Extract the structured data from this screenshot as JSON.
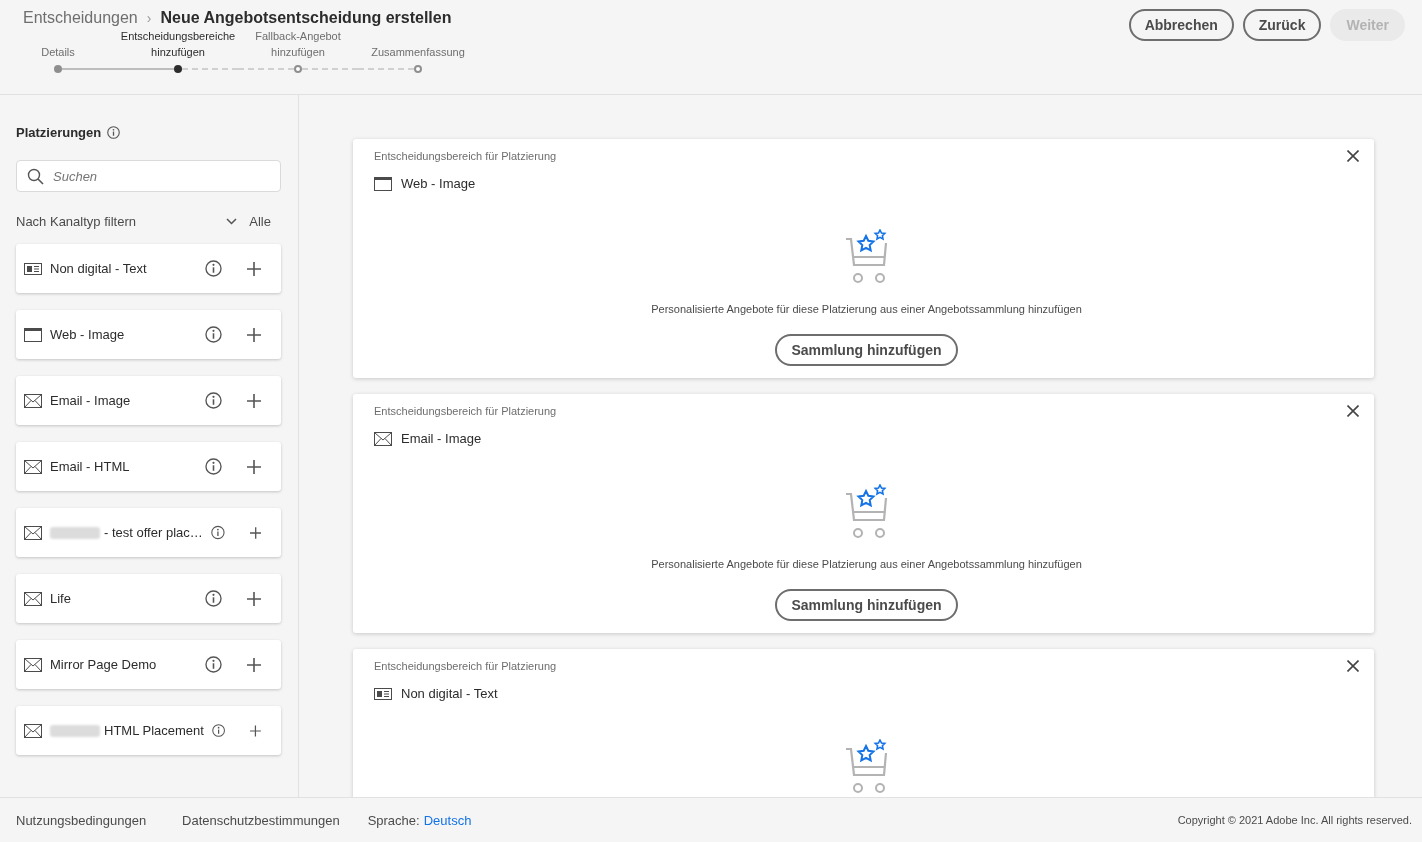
{
  "breadcrumb": {
    "parent": "Entscheidungen",
    "separator": "›",
    "current": "Neue Angebotsentscheidung erstellen"
  },
  "steps": [
    {
      "label": "Details",
      "kind": "done"
    },
    {
      "label": "Entscheidungsbereiche hinzufügen",
      "kind": "current"
    },
    {
      "label": "Fallback-Angebot hinzufügen",
      "kind": "upcoming"
    },
    {
      "label": "Zusammenfassung",
      "kind": "upcoming"
    }
  ],
  "header_buttons": [
    {
      "label": "Abbrechen",
      "disabled": false
    },
    {
      "label": "Zurück",
      "disabled": false
    },
    {
      "label": "Weiter",
      "disabled": true
    }
  ],
  "sidebar": {
    "title": "Platzierungen",
    "search": {
      "placeholder": "Suchen"
    },
    "filter": {
      "label": "Nach Kanaltyp filtern",
      "value": "Alle"
    },
    "placements": [
      {
        "label": "Non digital - Text",
        "kind": "print",
        "redacted_prefix": false
      },
      {
        "label": "Web - Image",
        "kind": "web",
        "redacted_prefix": false
      },
      {
        "label": "Email - Image",
        "kind": "email",
        "redacted_prefix": false
      },
      {
        "label": "Email - HTML",
        "kind": "email",
        "redacted_prefix": false
      },
      {
        "label": "- test offer plac…",
        "kind": "email",
        "redacted_prefix": true
      },
      {
        "label": "Life",
        "kind": "email",
        "redacted_prefix": false
      },
      {
        "label": "Mirror Page Demo",
        "kind": "email",
        "redacted_prefix": false
      },
      {
        "label": "HTML Placement",
        "kind": "email",
        "redacted_prefix": true
      }
    ]
  },
  "scopes": [
    {
      "caption": "Entscheidungsbereich für Platzierung",
      "placement": "Web - Image",
      "kind": "web",
      "message": "Personalisierte Angebote für diese Platzierung aus einer Angebotssammlung hinzufügen",
      "button": "Sammlung hinzufügen"
    },
    {
      "caption": "Entscheidungsbereich für Platzierung",
      "placement": "Email - Image",
      "kind": "email",
      "message": "Personalisierte Angebote für diese Platzierung aus einer Angebotssammlung hinzufügen",
      "button": "Sammlung hinzufügen"
    },
    {
      "caption": "Entscheidungsbereich für Platzierung",
      "placement": "Non digital - Text",
      "kind": "print"
    }
  ],
  "footer": {
    "links": [
      "Nutzungsbedingungen",
      "Datenschutzbestimmungen"
    ],
    "language_label": "Sprache:",
    "language": "Deutsch",
    "copyright": "Copyright ©  2021 Adobe Inc.  All rights reserved."
  }
}
